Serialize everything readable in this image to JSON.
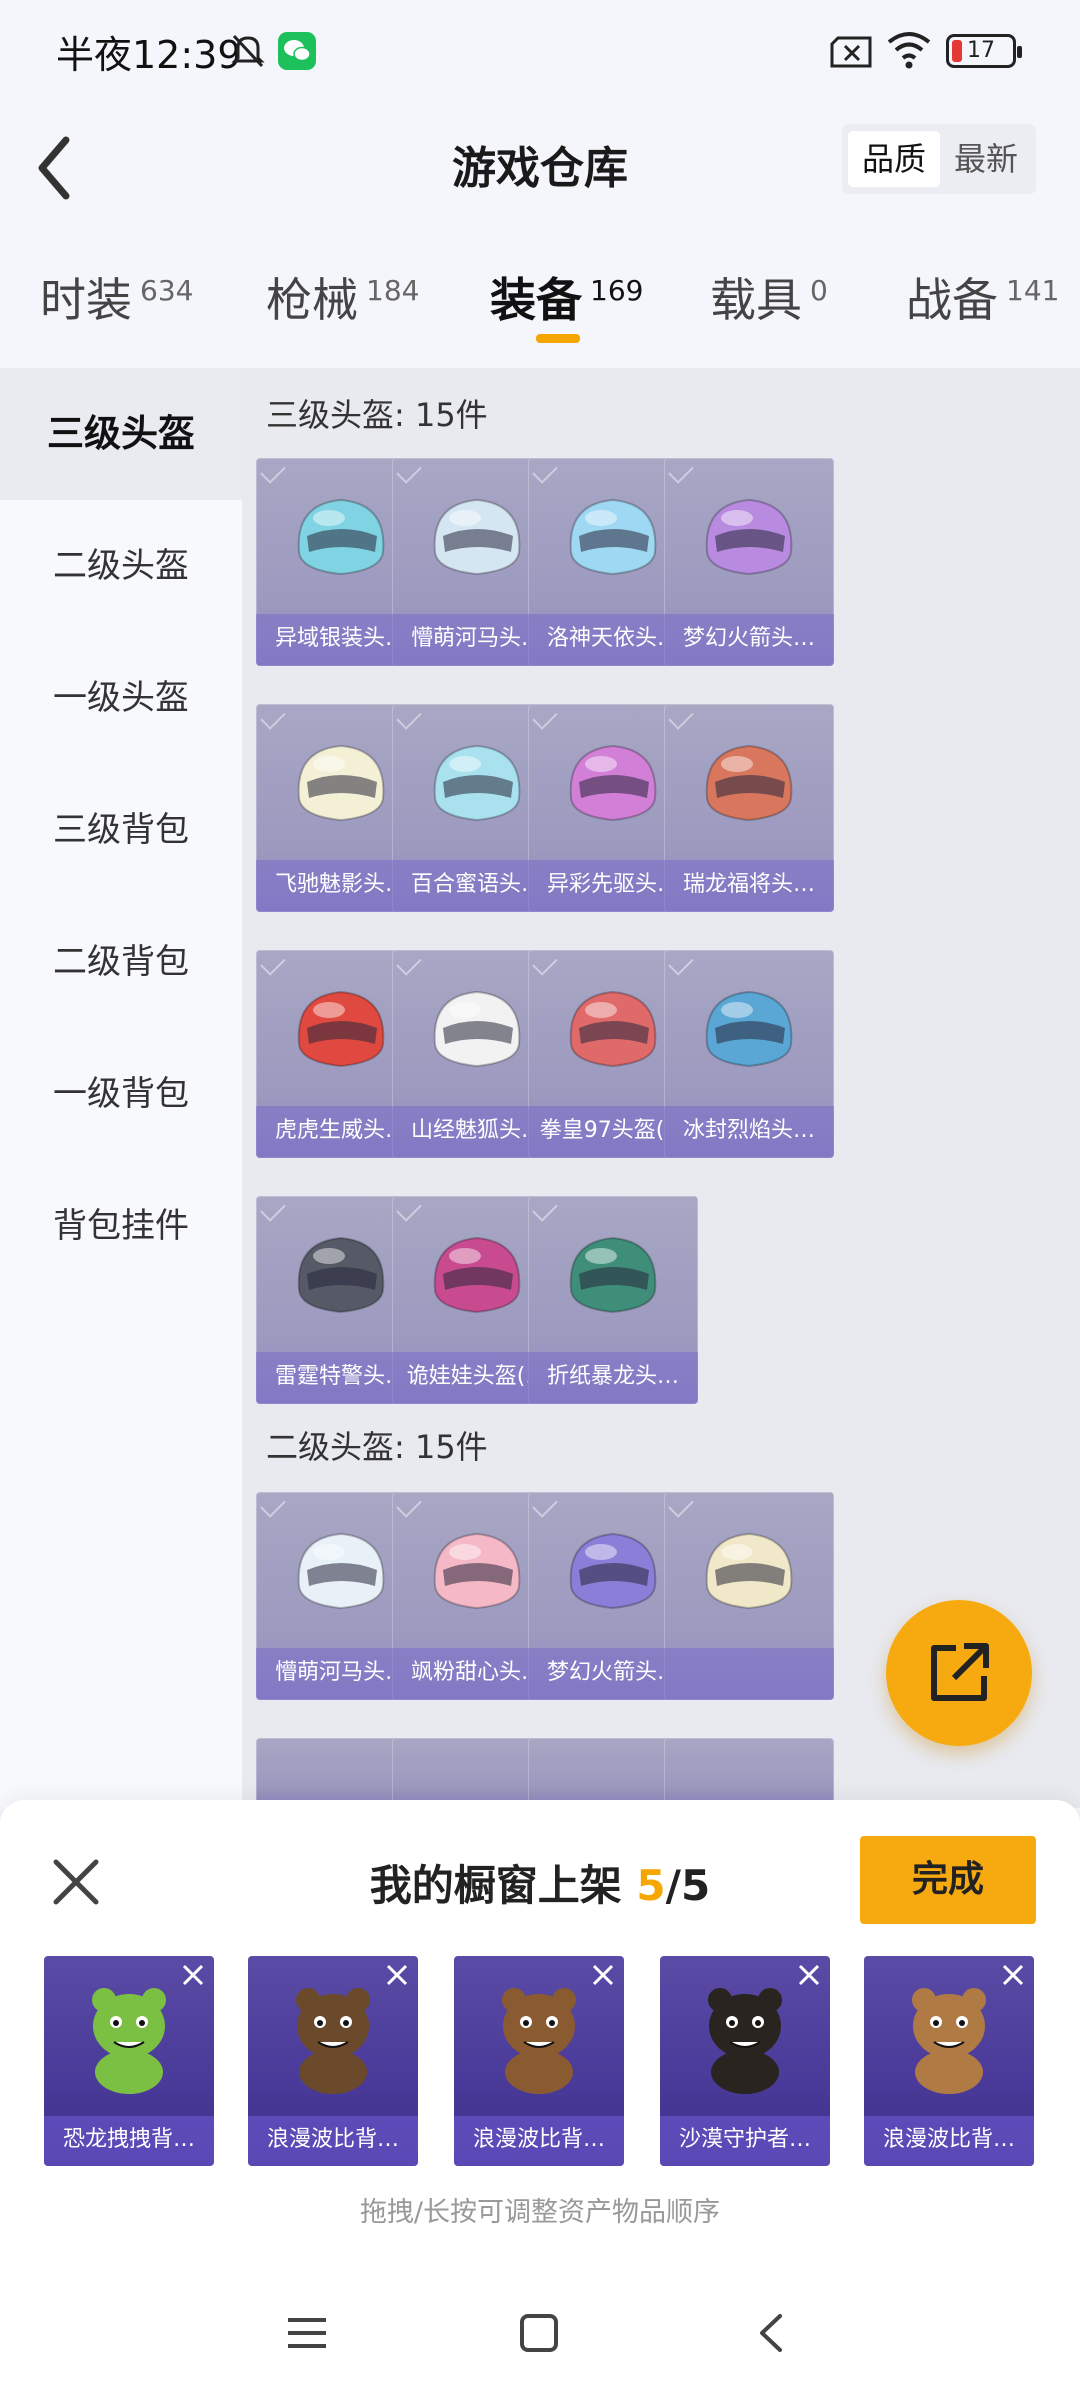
{
  "status_bar": {
    "time": "半夜12:39",
    "battery": "17",
    "battery_level": 0.17
  },
  "header": {
    "title": "游戏仓库",
    "sort_options": [
      {
        "label": "品质",
        "active": true
      },
      {
        "label": "最新",
        "active": false
      }
    ]
  },
  "category_tabs": [
    {
      "label": "时装",
      "count": "634"
    },
    {
      "label": "枪械",
      "count": "184"
    },
    {
      "label": "装备",
      "count": "169",
      "active": true
    },
    {
      "label": "载具",
      "count": "0"
    },
    {
      "label": "战备",
      "count": "141"
    }
  ],
  "sidebar": {
    "items": [
      {
        "label": "三级头盔",
        "active": true
      },
      {
        "label": "二级头盔"
      },
      {
        "label": "一级头盔"
      },
      {
        "label": "三级背包"
      },
      {
        "label": "二级背包"
      },
      {
        "label": "一级背包"
      },
      {
        "label": "背包挂件"
      }
    ]
  },
  "sections": [
    {
      "title": "三级头盔: 15件",
      "items": [
        {
          "name": "异域银装头…",
          "icon": "helmet-icon",
          "color": "#7fd3e3"
        },
        {
          "name": "懵萌河马头…",
          "icon": "helmet-icon",
          "color": "#d5e6f3"
        },
        {
          "name": "洛神天依头…",
          "icon": "helmet-icon",
          "color": "#9fd8f2"
        },
        {
          "name": "梦幻火箭头…",
          "icon": "helmet-icon",
          "color": "#b98be0"
        },
        {
          "name": "飞驰魅影头…",
          "icon": "helmet-icon",
          "color": "#f3f0d6"
        },
        {
          "name": "百合蜜语头…",
          "icon": "helmet-icon",
          "color": "#a9e2ee"
        },
        {
          "name": "异彩先驱头…",
          "icon": "helmet-icon",
          "color": "#d27fd8"
        },
        {
          "name": "瑞龙福将头…",
          "icon": "helmet-icon",
          "color": "#d8775e"
        },
        {
          "name": "虎虎生威头…",
          "icon": "helmet-icon",
          "color": "#e0493f"
        },
        {
          "name": "山经魅狐头…",
          "icon": "helmet-icon",
          "color": "#f2f2f2"
        },
        {
          "name": "拳皇97头盔(…",
          "icon": "helmet-icon",
          "color": "#e06a6a"
        },
        {
          "name": "冰封烈焰头…",
          "icon": "helmet-icon",
          "color": "#5aa7d6"
        },
        {
          "name": "雷霆特警头…",
          "icon": "helmet-icon",
          "color": "#555a66"
        },
        {
          "name": "诡娃娃头盔(…",
          "icon": "helmet-icon",
          "color": "#c94b8f"
        },
        {
          "name": "折纸暴龙头…",
          "icon": "helmet-icon",
          "color": "#3f8e7a"
        }
      ]
    },
    {
      "title": "二级头盔: 15件",
      "items": [
        {
          "name": "懵萌河马头…",
          "icon": "helmet-icon",
          "color": "#e8f0f8"
        },
        {
          "name": "飒粉甜心头…",
          "icon": "helmet-icon",
          "color": "#f5b8c6"
        },
        {
          "name": "梦幻火箭头…",
          "icon": "helmet-icon",
          "color": "#8a7fd8"
        },
        {
          "name": "",
          "icon": "helmet-icon",
          "color": "#f0e8c8"
        }
      ]
    }
  ],
  "showcase": {
    "title_prefix": "我的橱窗上架 ",
    "count_current": "5",
    "count_total": "/5",
    "done_label": "完成",
    "hint": "拖拽/长按可调整资产物品顺序",
    "items": [
      {
        "name": "恐龙拽拽背…",
        "icon": "backpack-icon",
        "color": "#7cc043"
      },
      {
        "name": "浪漫波比背…",
        "icon": "backpack-icon",
        "color": "#6b4a2b"
      },
      {
        "name": "浪漫波比背…",
        "icon": "backpack-icon",
        "color": "#8a5a30"
      },
      {
        "name": "沙漠守护者…",
        "icon": "backpack-icon",
        "color": "#2a2420"
      },
      {
        "name": "浪漫波比背…",
        "icon": "backpack-icon",
        "color": "#b07a45"
      }
    ]
  },
  "colors": {
    "accent": "#f7aa10",
    "card": "#9c99bf",
    "showcase_card": "#4a3a99"
  }
}
